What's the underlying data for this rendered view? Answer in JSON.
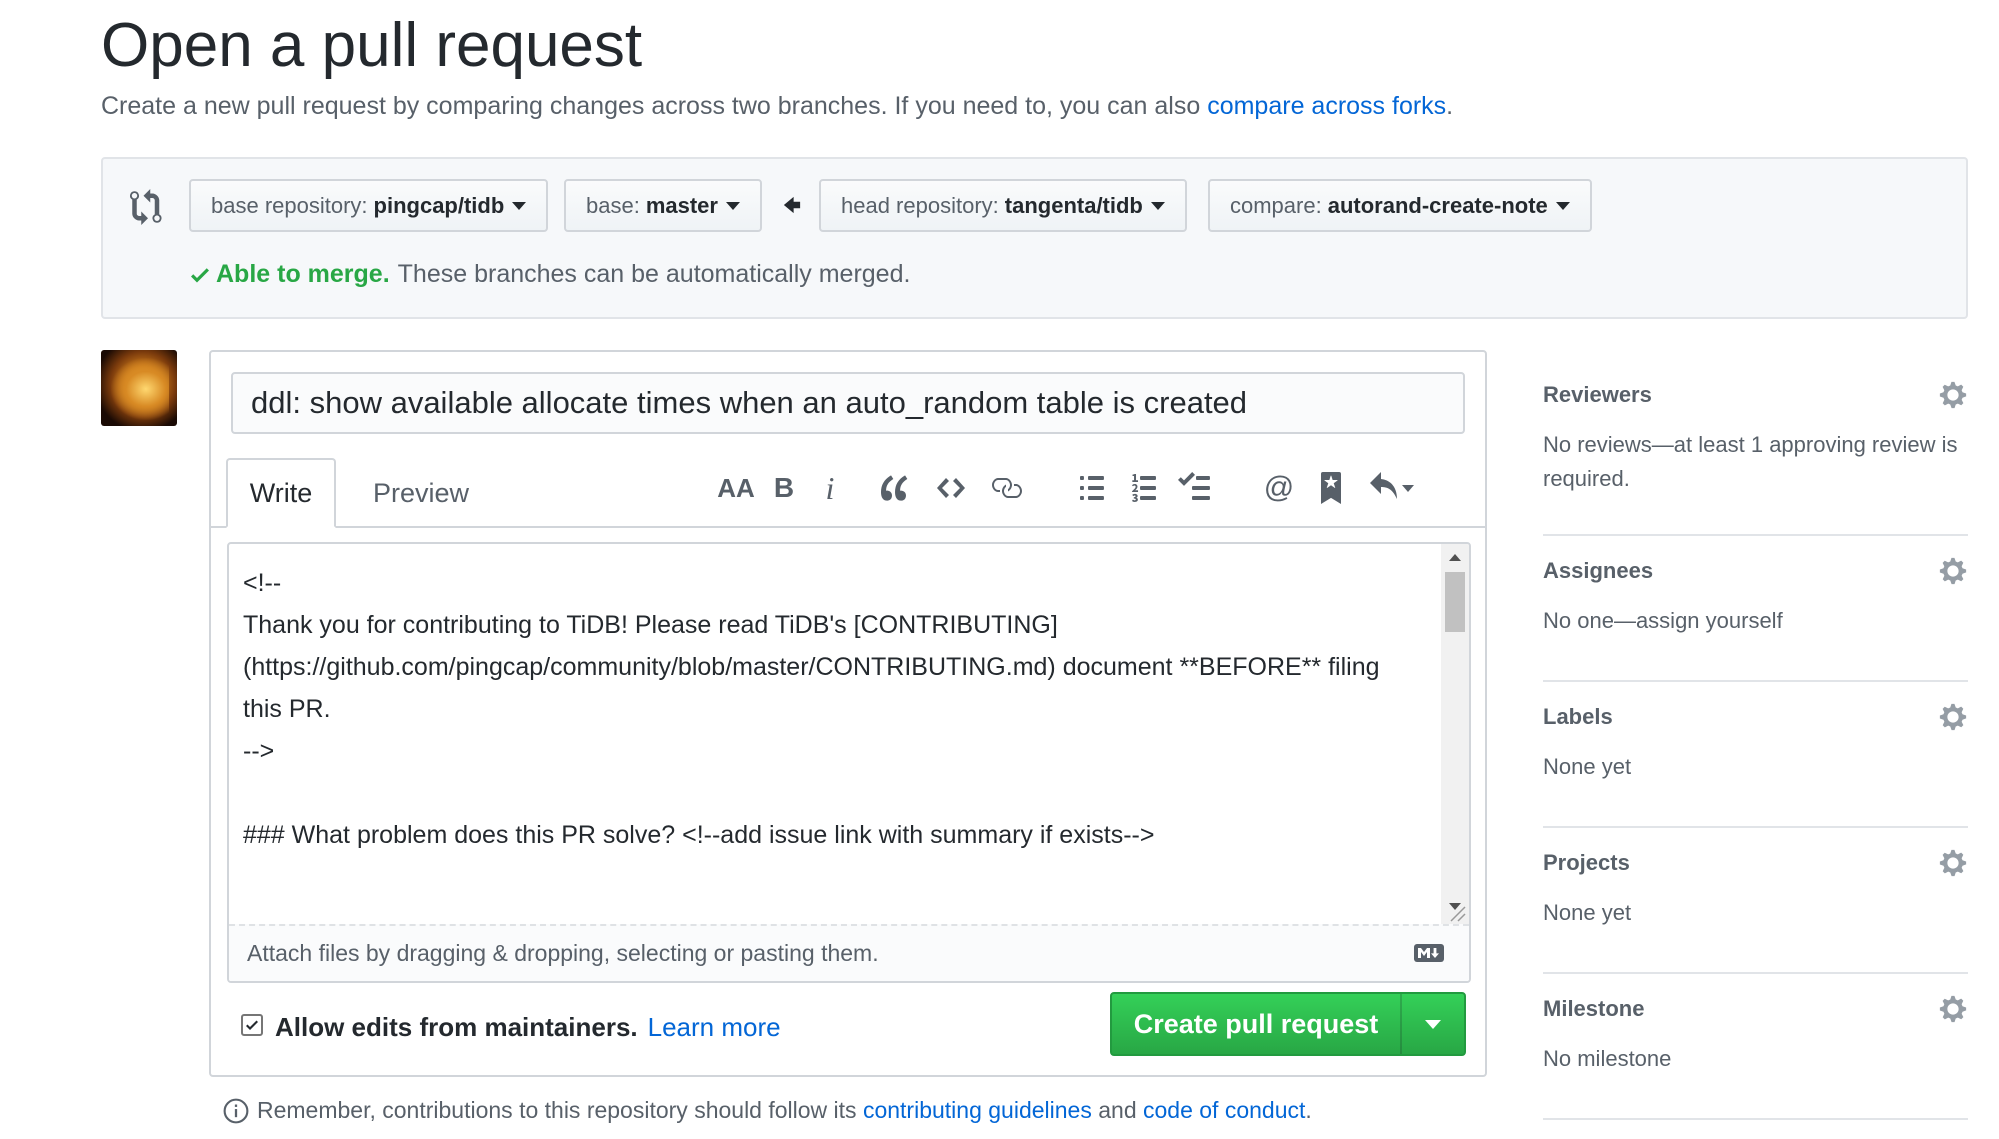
{
  "page": {
    "title": "Open a pull request",
    "subtitle": "Create a new pull request by comparing changes across two branches. If you need to, you can also",
    "subtitle_link": "compare across forks",
    "subtitle_end": "."
  },
  "range": {
    "base_repo_label": "base repository:",
    "base_repo": "pingcap/tidb",
    "base_label": "base:",
    "base": "master",
    "head_repo_label": "head repository:",
    "head_repo": "tangenta/tidb",
    "compare_label": "compare:",
    "compare": "autorand-create-note",
    "merge_ok": "Able to merge.",
    "merge_text": "These branches can be automatically merged."
  },
  "composer": {
    "title_value": "ddl: show available allocate times when an auto_random table is created",
    "tab_write": "Write",
    "tab_preview": "Preview",
    "toolbar": [
      "header-icon",
      "bold-icon",
      "italic-icon",
      "quote-icon",
      "code-icon",
      "link-icon",
      "bulleted-list-icon",
      "numbered-list-icon",
      "task-list-icon",
      "mention-icon",
      "saved-reply-icon",
      "reply-icon"
    ],
    "toolbar_header_text": "AA",
    "toolbar_bold_text": "B",
    "toolbar_italic_text": "i",
    "toolbar_mention_text": "@",
    "body": "<!--\nThank you for contributing to TiDB! Please read TiDB's [CONTRIBUTING](https://github.com/pingcap/community/blob/master/CONTRIBUTING.md) document **BEFORE** filing this PR.\n-->\n\n### What problem does this PR solve? <!--add issue link with summary if exists-->",
    "attach_text": "Attach files by dragging & dropping, selecting or pasting them.",
    "allow_edits_label": "Allow edits from maintainers.",
    "allow_edits_checked": true,
    "learn_more": "Learn more",
    "create_button": "Create pull request"
  },
  "footer": {
    "remember": "Remember, contributions to this repository should follow its",
    "guidelines": "contributing guidelines",
    "and": "and",
    "conduct": "code of conduct",
    "end": "."
  },
  "sidebar": {
    "reviewers_title": "Reviewers",
    "reviewers_text": "No reviews—at least 1 approving review is required.",
    "assignees_title": "Assignees",
    "assignees_text": "No one—assign yourself",
    "labels_title": "Labels",
    "labels_text": "None yet",
    "projects_title": "Projects",
    "projects_text": "None yet",
    "milestone_title": "Milestone",
    "milestone_text": "No milestone"
  },
  "colors": {
    "accent_link": "#0366d6",
    "success": "#28a745",
    "text_muted": "#586069"
  }
}
